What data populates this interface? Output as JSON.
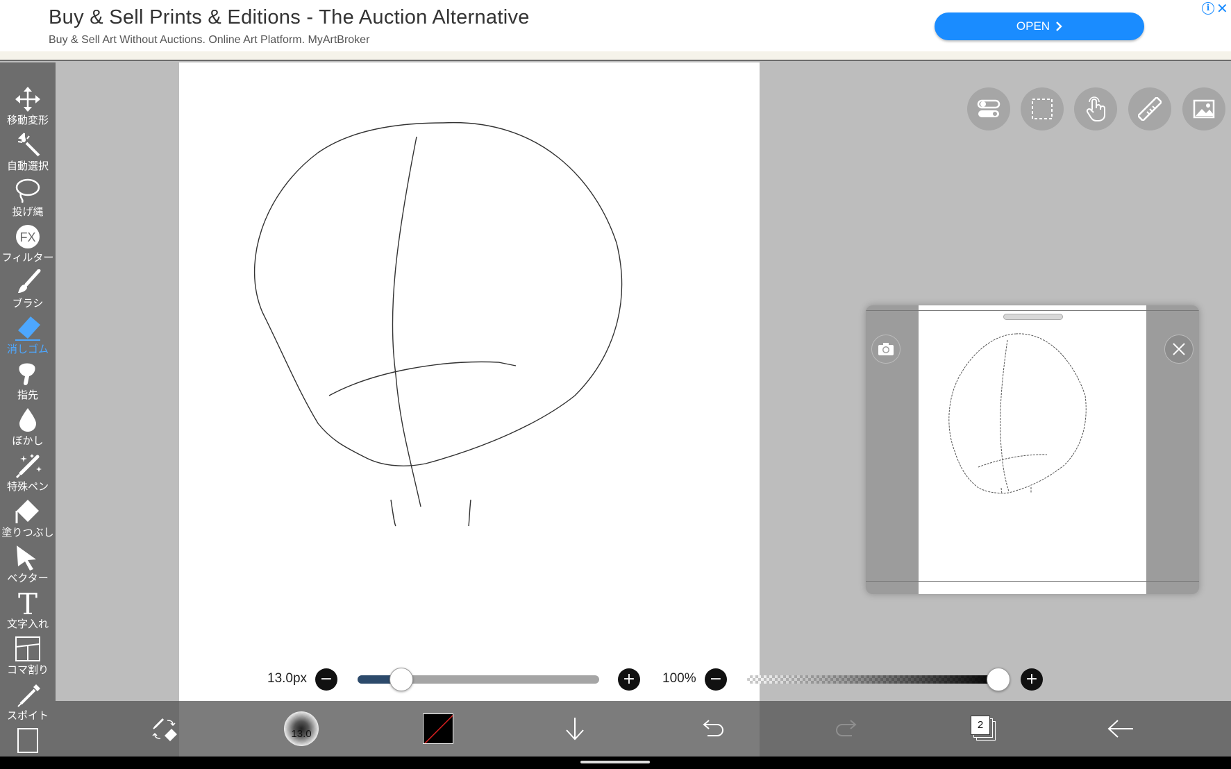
{
  "ad": {
    "title": "Buy & Sell Prints & Editions - The Auction Alternative",
    "subtitle": "Buy & Sell Art Without Auctions. Online Art Platform. MyArtBroker",
    "open_label": "OPEN",
    "info_icon": "info-icon",
    "close_icon": "close-icon"
  },
  "left_toolbar": {
    "items": [
      {
        "label": "移動変形",
        "icon": "move-icon"
      },
      {
        "label": "自動選択",
        "icon": "magic-wand-icon"
      },
      {
        "label": "投げ縄",
        "icon": "lasso-icon"
      },
      {
        "label": "フィルター",
        "icon": "fx-icon",
        "icon_text": "FX"
      },
      {
        "label": "ブラシ",
        "icon": "brush-icon"
      },
      {
        "label": "消しゴム",
        "icon": "eraser-icon",
        "active": true
      },
      {
        "label": "指先",
        "icon": "finger-icon"
      },
      {
        "label": "ぼかし",
        "icon": "blur-drop-icon"
      },
      {
        "label": "特殊ペン",
        "icon": "special-pen-icon"
      },
      {
        "label": "塗りつぶし",
        "icon": "fill-bucket-icon"
      },
      {
        "label": "ベクター",
        "icon": "vector-cursor-icon"
      },
      {
        "label": "文字入れ",
        "icon": "text-icon",
        "icon_text": "T"
      },
      {
        "label": "コマ割り",
        "icon": "frame-divider-icon"
      },
      {
        "label": "スポイト",
        "icon": "eyedropper-icon"
      }
    ],
    "active_color": "#4da7ff"
  },
  "top_buttons": [
    "toggle-settings-icon",
    "selection-icon",
    "hand-touch-icon",
    "ruler-icon",
    "image-icon"
  ],
  "navigator": {
    "camera_icon": "camera-icon",
    "close_icon": "close-icon"
  },
  "brush_controls": {
    "size_label": "13.0px",
    "size_fraction": 0.18,
    "opacity_label": "100%",
    "opacity_fraction": 1.0,
    "accent": "#2c4a6b"
  },
  "bottom_bar": {
    "brush_size_text": "13.0",
    "layer_count": "2",
    "icons": [
      "brush-eraser-swap-icon",
      "brush-preview",
      "color-swatch",
      "download-arrow-icon",
      "undo-icon",
      "redo-icon",
      "layers-icon",
      "back-arrow-icon"
    ]
  }
}
